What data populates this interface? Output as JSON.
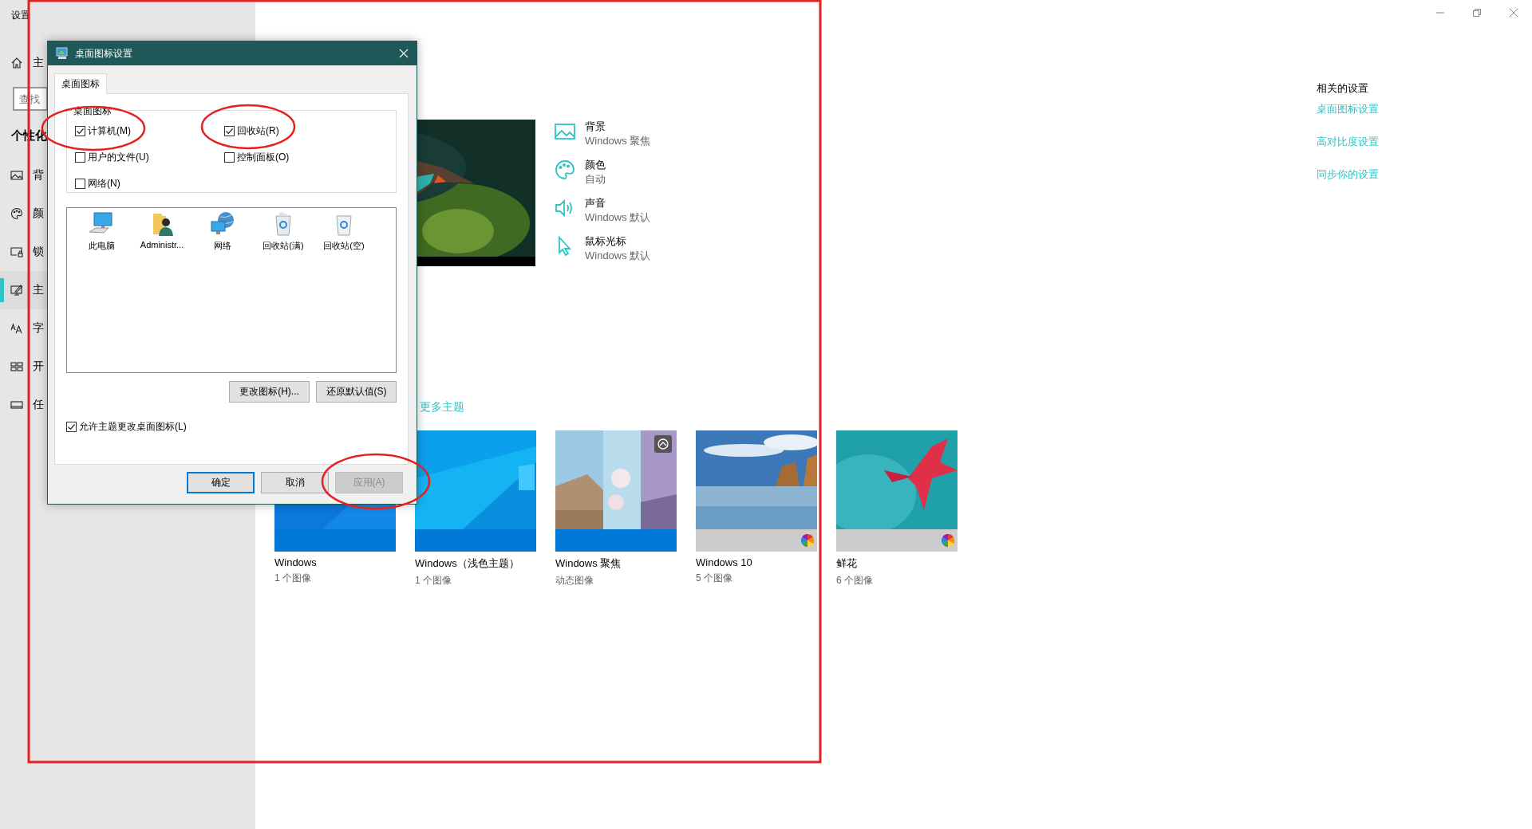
{
  "settings_window": {
    "title": "设置"
  },
  "sidebar": {
    "items": [
      {
        "kind": "nav",
        "label": "主",
        "selected": false
      },
      {
        "kind": "search",
        "placeholder": "查找"
      },
      {
        "kind": "heading",
        "label": "个性化"
      },
      {
        "kind": "nav",
        "label": "背",
        "selected": false
      },
      {
        "kind": "nav",
        "label": "颜",
        "selected": false
      },
      {
        "kind": "nav",
        "label": "锁",
        "selected": false
      },
      {
        "kind": "nav",
        "label": "主",
        "selected": true
      },
      {
        "kind": "nav",
        "label": "字",
        "selected": false
      },
      {
        "kind": "nav",
        "label": "开",
        "selected": false
      },
      {
        "kind": "nav",
        "label": "任",
        "selected": false
      }
    ]
  },
  "theme_summary": [
    {
      "title": "背景",
      "value": "Windows 聚焦"
    },
    {
      "title": "颜色",
      "value": "自动"
    },
    {
      "title": "声音",
      "value": "Windows 默认"
    },
    {
      "title": "鼠标光标",
      "value": "Windows 默认"
    }
  ],
  "more_themes_link": "更多主题",
  "themes": [
    {
      "name": "Windows",
      "subtitle": "1 个图像",
      "color": "#0078d7",
      "multicolor": false,
      "kind": "blue"
    },
    {
      "name": "Windows（浅色主题）",
      "subtitle": "1 个图像",
      "color": "#0078d7",
      "slideshow": false,
      "multicolor": false,
      "kind": "light"
    },
    {
      "name": "Windows 聚焦",
      "subtitle": "动态图像",
      "color": "#0078d7",
      "slideshow": true,
      "multicolor": false,
      "kind": "spotlight"
    },
    {
      "name": "Windows 10",
      "subtitle": "5 个图像",
      "color": "#cccccc",
      "slideshow": false,
      "multicolor": true,
      "kind": "beach"
    },
    {
      "name": "鲜花",
      "subtitle": "6 个图像",
      "color": "#cccccc",
      "slideshow": false,
      "multicolor": true,
      "kind": "flower"
    }
  ],
  "related_settings": {
    "title": "相关的设置",
    "links": [
      "桌面图标设置",
      "高对比度设置",
      "同步你的设置"
    ]
  },
  "dialog": {
    "title": "桌面图标设置",
    "tabs": [
      {
        "label": "桌面图标",
        "selected": true
      }
    ],
    "group_title": "桌面图标",
    "checkboxes": [
      {
        "label": "计算机(M)",
        "checked": true
      },
      {
        "label": "回收站(R)",
        "checked": true
      },
      {
        "label": "用户的文件(U)",
        "checked": false
      },
      {
        "label": "控制面板(O)",
        "checked": false
      },
      {
        "label": "网络(N)",
        "checked": false
      }
    ],
    "icons": [
      {
        "label": "此电脑"
      },
      {
        "label": "Administr..."
      },
      {
        "label": "网络"
      },
      {
        "label": "回收站(满)"
      },
      {
        "label": "回收站(空)"
      }
    ],
    "icon_buttons": [
      "更改图标(H)...",
      "还原默认值(S)"
    ],
    "allow_theme": {
      "label": "允许主题更改桌面图标(L)",
      "checked": true
    },
    "footer_buttons": [
      {
        "label": "确定",
        "kind": "default",
        "disabled": false
      },
      {
        "label": "取消",
        "kind": "normal",
        "disabled": false
      },
      {
        "label": "应用(A)",
        "kind": "normal",
        "disabled": true
      }
    ]
  },
  "annotations": [
    {
      "kind": "rectangle"
    },
    {
      "kind": "ellipse"
    },
    {
      "kind": "ellipse"
    },
    {
      "kind": "ellipse"
    }
  ]
}
